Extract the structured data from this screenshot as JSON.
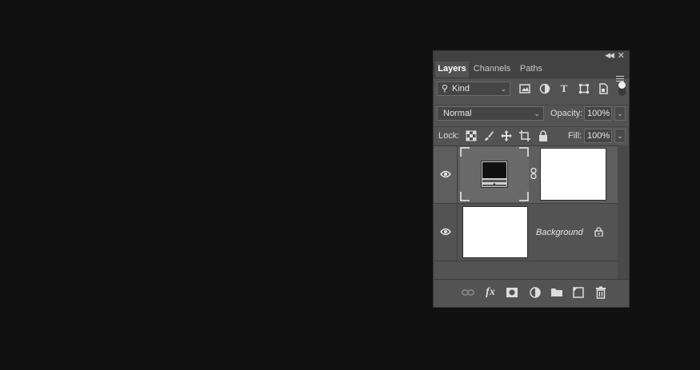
{
  "panel": {
    "tabs": [
      {
        "label": "Layers",
        "active": true
      },
      {
        "label": "Channels",
        "active": false
      },
      {
        "label": "Paths",
        "active": false
      }
    ],
    "filter": {
      "kind_label": "Kind"
    },
    "blend": {
      "mode": "Normal",
      "opacity_label": "Opacity:",
      "opacity_value": "100%"
    },
    "lock": {
      "label": "Lock:",
      "fill_label": "Fill:",
      "fill_value": "100%"
    },
    "layers": [
      {
        "name": "",
        "type": "adjustment-with-mask",
        "visible": true
      },
      {
        "name": "Background",
        "type": "background",
        "visible": true,
        "locked": true
      }
    ],
    "footer_icons": [
      "link-icon",
      "fx-icon",
      "mask-icon",
      "adjustment-icon",
      "folder-icon",
      "new-layer-icon",
      "trash-icon"
    ]
  },
  "colors": {
    "background": "#111111",
    "panel": "#535353",
    "header": "#424242"
  }
}
